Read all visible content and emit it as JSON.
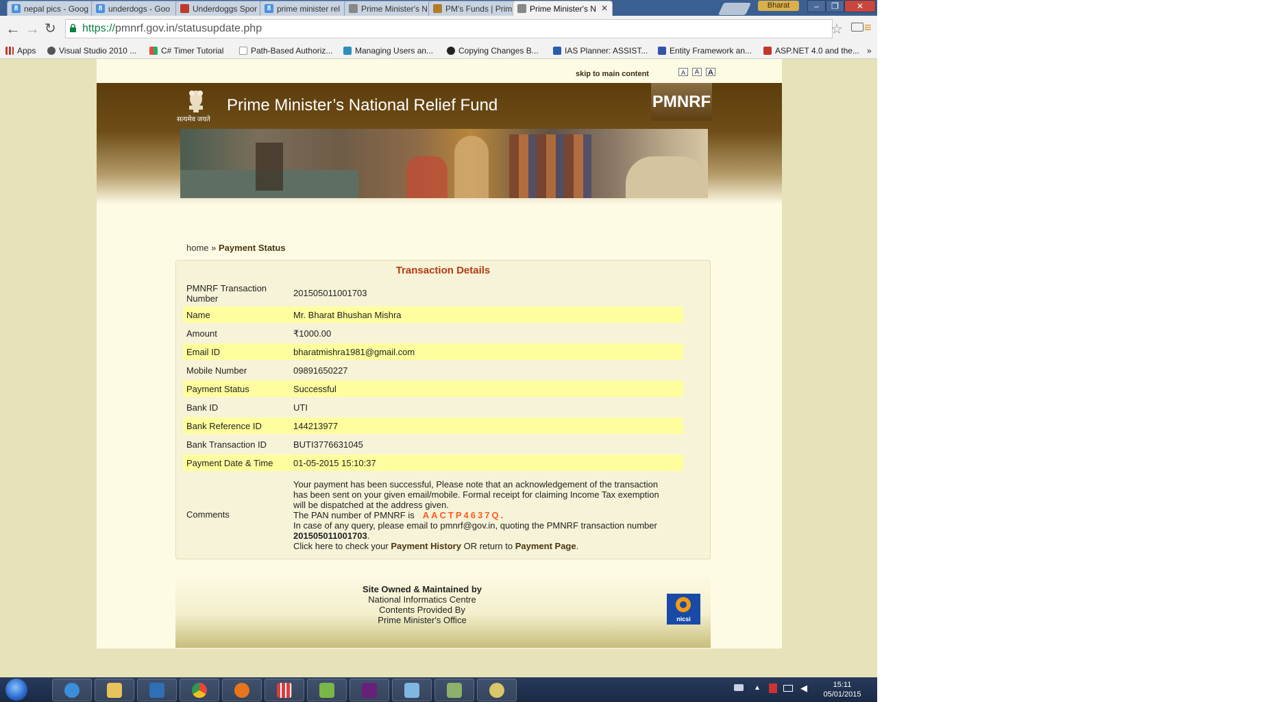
{
  "browser": {
    "tabs": [
      {
        "label": "nepal pics - Goog",
        "icon": "google-icon",
        "color": "#4a90e2"
      },
      {
        "label": "underdogs - Goo",
        "icon": "google-icon",
        "color": "#4a90e2"
      },
      {
        "label": "Underdoggs Spor",
        "icon": "underdoggs-icon",
        "color": "#c0392b"
      },
      {
        "label": "prime minister rel",
        "icon": "google-icon",
        "color": "#4a90e2"
      },
      {
        "label": "Prime Minister's N",
        "icon": "page-icon",
        "color": "#888888"
      },
      {
        "label": "PM's Funds | Prim",
        "icon": "emblem-icon",
        "color": "#b07d2a"
      },
      {
        "label": "Prime Minister's N",
        "icon": "page-icon",
        "color": "#888888"
      }
    ],
    "user_badge": "Bharat",
    "url_scheme": "https://",
    "url_rest": "pmnrf.gov.in/statusupdate.php",
    "bookmarks": [
      {
        "label": "Apps",
        "icon": "apps-grid-icon",
        "color": "#c0392b"
      },
      {
        "label": "Visual Studio 2010 ...",
        "icon": "wordpress-icon",
        "color": "#555555"
      },
      {
        "label": "C# Timer Tutorial",
        "icon": "colorful-tiles-icon",
        "color": "#e74c3c"
      },
      {
        "label": "Path-Based Authoriz...",
        "icon": "page-icon",
        "color": "#999999"
      },
      {
        "label": "Managing Users an...",
        "icon": "funnel-icon",
        "color": "#2a8fbd"
      },
      {
        "label": "Copying Changes B...",
        "icon": "github-icon",
        "color": "#222222"
      },
      {
        "label": "IAS Planner: ASSIST...",
        "icon": "ias-icon",
        "color": "#2a5db0"
      },
      {
        "label": "Entity Framework an...",
        "icon": "asp-icon",
        "color": "#3553a8"
      },
      {
        "label": "ASP.NET 4.0 and the...",
        "icon": "asp-net-icon",
        "color": "#c0392b"
      }
    ],
    "bookmarks_overflow": "»"
  },
  "page": {
    "skip_link": "skip to main content",
    "font_sizes": [
      "A",
      "A",
      "A"
    ],
    "site_title": "Prime Minister’s National Relief Fund",
    "emblem_motto": "सत्यमेव जयते",
    "badge": "PMNRF",
    "breadcrumb": {
      "home": "home",
      "sep": "»",
      "current": "Payment Status"
    },
    "card_title": "Transaction Details",
    "rows": [
      {
        "label": "PMNRF Transaction Number",
        "value": "201505011001703"
      },
      {
        "label": "Name",
        "value": "Mr. Bharat Bhushan Mishra"
      },
      {
        "label": "Amount",
        "value": "₹1000.00"
      },
      {
        "label": "Email ID",
        "value": "bharatmishra1981@gmail.com"
      },
      {
        "label": "Mobile Number",
        "value": "09891650227"
      },
      {
        "label": "Payment Status",
        "value": "Successful"
      },
      {
        "label": "Bank ID",
        "value": "UTI"
      },
      {
        "label": "Bank Reference ID",
        "value": "144213977"
      },
      {
        "label": "Bank Transaction ID",
        "value": "BUTI3776631045"
      },
      {
        "label": "Payment Date & Time",
        "value": "01-05-2015 15:10:37"
      }
    ],
    "comments": {
      "label": "Comments",
      "line1": "Your payment has been successful, Please note that an acknowledgement of the transaction has been sent on your given email/mobile. Formal receipt for claiming Income Tax exemption will be dispatched at the address given.",
      "pan_text": "The PAN number of PMNRF is",
      "pan": "AACTP4637Q.",
      "query_text": "In case of any query, please email to pmnrf@gov.in, quoting the PMNRF transaction number",
      "txn": "201505011001703",
      "txn_suffix": ".",
      "click_text": "Click here to check your",
      "history_link": "Payment History",
      "or_text": "OR return to",
      "payment_link": "Payment Page",
      "end": "."
    },
    "footer": {
      "line1": "Site Owned & Maintained by",
      "line2": "National Informatics Centre",
      "line3": "Contents Provided By",
      "line4": "Prime Minister's Office",
      "nicsi": "nicsi"
    }
  },
  "taskbar": {
    "apps": [
      {
        "name": "internet-explorer-icon",
        "color": "#3a8fd8"
      },
      {
        "name": "file-explorer-icon",
        "color": "#e6c35c"
      },
      {
        "name": "powershell-icon",
        "color": "#2f6fb5"
      },
      {
        "name": "chrome-icon",
        "color": "#e8463b"
      },
      {
        "name": "firefox-icon",
        "color": "#e8741c"
      },
      {
        "name": "tiles-app-icon",
        "color": "#d93f3f"
      },
      {
        "name": "notepad-plus-icon",
        "color": "#7ab648"
      },
      {
        "name": "visual-studio-icon",
        "color": "#68217a"
      },
      {
        "name": "notes-app-icon",
        "color": "#7fb7e0"
      },
      {
        "name": "calculator-icon",
        "color": "#8db06a"
      },
      {
        "name": "paint-icon",
        "color": "#d9c76a"
      }
    ],
    "time": "15:11",
    "date": "05/01/2015"
  }
}
